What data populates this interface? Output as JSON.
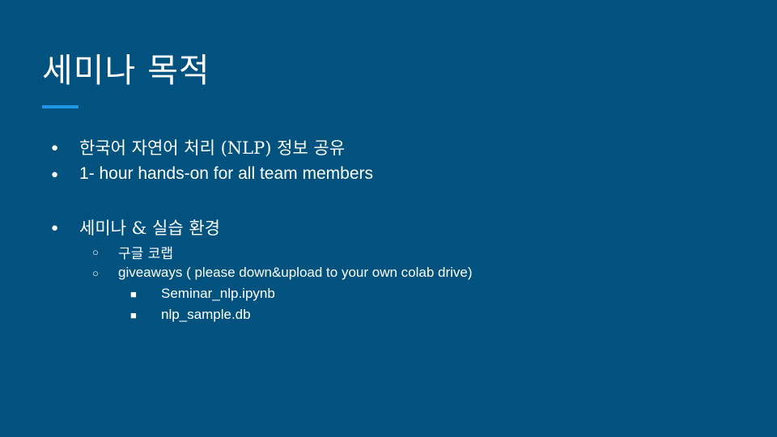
{
  "slide": {
    "title": "세미나 목적",
    "accent_color": "#1e96e6",
    "background_color": "#01527f"
  },
  "bullets": {
    "level1_glyph": "●",
    "level2_glyph": "○",
    "level3_glyph": "■",
    "items": [
      {
        "text": "한국어 자연어 처리 (NLP) 정보 공유"
      },
      {
        "text": "1- hour hands-on for all team members"
      },
      {
        "text": "세미나 & 실습 환경"
      }
    ],
    "sub_items": [
      {
        "text": "구글 코랩"
      },
      {
        "text": "giveaways ( please down&upload to your own colab drive)"
      }
    ],
    "sub_sub_items": [
      {
        "text": "Seminar_nlp.ipynb"
      },
      {
        "text": "nlp_sample.db"
      }
    ]
  }
}
